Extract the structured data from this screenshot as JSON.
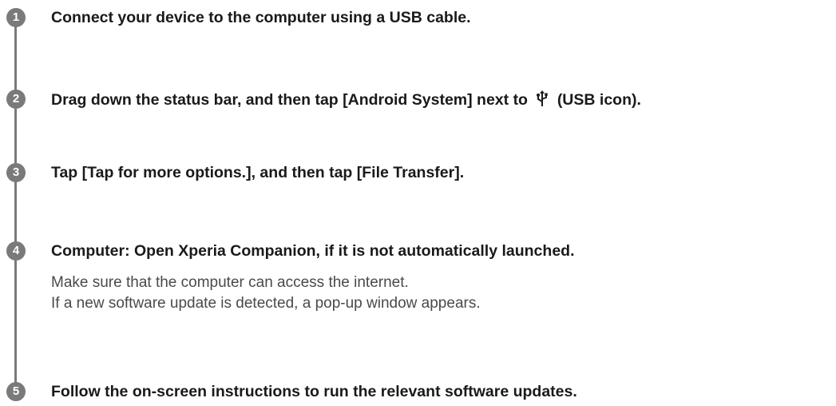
{
  "steps": [
    {
      "number": "1",
      "title": "Connect your device to the computer using a USB cable."
    },
    {
      "number": "2",
      "title_before_icon": "Drag down the status bar, and then tap [Android System] next to",
      "icon": "usb-icon",
      "title_after_icon": "(USB icon)."
    },
    {
      "number": "3",
      "title": "Tap [Tap for more options.], and then tap [File Transfer]."
    },
    {
      "number": "4",
      "title": "Computer: Open Xperia Companion, if it is not automatically launched.",
      "body": [
        "Make sure that the computer can access the internet.",
        "If a new software update is detected, a pop-up window appears."
      ]
    },
    {
      "number": "5",
      "title": "Follow the on-screen instructions to run the relevant software updates."
    }
  ],
  "colors": {
    "timeline": "#7a7a7a",
    "title_text": "#1a1a1a",
    "body_text": "#4a4a4a"
  }
}
